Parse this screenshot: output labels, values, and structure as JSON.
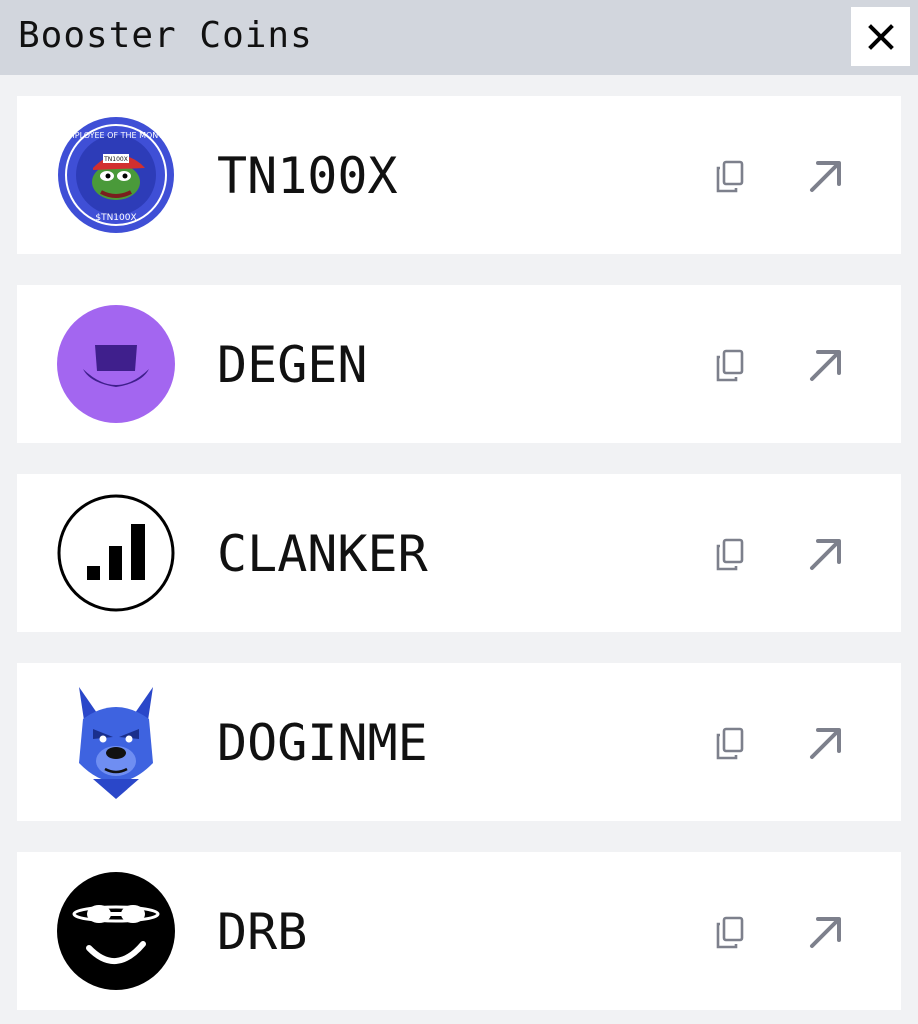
{
  "header": {
    "title": "Booster Coins",
    "close_icon": "close-icon"
  },
  "coins": [
    {
      "name": "TN100X",
      "avatar": "pepe-employee-of-the-month-logo",
      "logo_text_top": "EMPLOYEE OF THE MONTH",
      "logo_text_bottom": "$TN100X",
      "logo_text_cap": "TN100X",
      "color": "#3f4fd6"
    },
    {
      "name": "DEGEN",
      "avatar": "purple-top-hat-logo",
      "color": "#a366f0"
    },
    {
      "name": "CLANKER",
      "avatar": "signal-bars-logo",
      "color": "#000000"
    },
    {
      "name": "DOGINME",
      "avatar": "blue-dog-logo",
      "color": "#2f56d6"
    },
    {
      "name": "DRB",
      "avatar": "black-smiley-sunglasses-logo",
      "color": "#000000"
    }
  ],
  "icons": {
    "copy": "copy-icon",
    "open": "arrow-up-right-icon"
  },
  "colors": {
    "header_bg": "#d2d6dd",
    "page_bg": "#f1f2f4",
    "icon_gray": "#7d808c"
  }
}
